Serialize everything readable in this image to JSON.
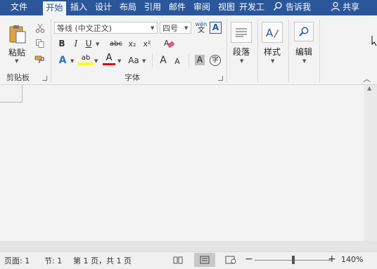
{
  "tabs": [
    {
      "label": "文件"
    },
    {
      "label": "开始"
    },
    {
      "label": "插入"
    },
    {
      "label": "设计"
    },
    {
      "label": "布局"
    },
    {
      "label": "引用"
    },
    {
      "label": "邮件"
    },
    {
      "label": "审阅"
    },
    {
      "label": "视图"
    },
    {
      "label": "开发工"
    }
  ],
  "tell_me": "告诉我",
  "share": "共享",
  "clipboard": {
    "paste": "粘贴",
    "group": "剪贴板"
  },
  "font": {
    "name": "等线 (中文正文)",
    "size": "四号",
    "phonetic_top": "wén",
    "phonetic_bottom": "文",
    "bold": "B",
    "italic": "I",
    "underline": "U",
    "strike": "abc",
    "subscript": "x₂",
    "superscript": "x²",
    "text_effects": "A",
    "highlight": "ab",
    "font_color": "A",
    "change_case": "Aa",
    "grow": "A",
    "shrink": "A",
    "char_shading": "A",
    "enclose": "字",
    "border_char": "A",
    "group": "字体"
  },
  "paragraph": {
    "label": "段落"
  },
  "styles": {
    "label": "样式"
  },
  "editing": {
    "label": "编辑"
  },
  "status": {
    "page": "页面: 1",
    "section": "节: 1",
    "page_of": "第 1 页，共 1 页",
    "zoom": "140%",
    "zoom_minus": "−",
    "zoom_plus": "+"
  },
  "colors": {
    "accent": "#2b579a",
    "highlight": "#ffff00",
    "font_color": "#e00000"
  }
}
